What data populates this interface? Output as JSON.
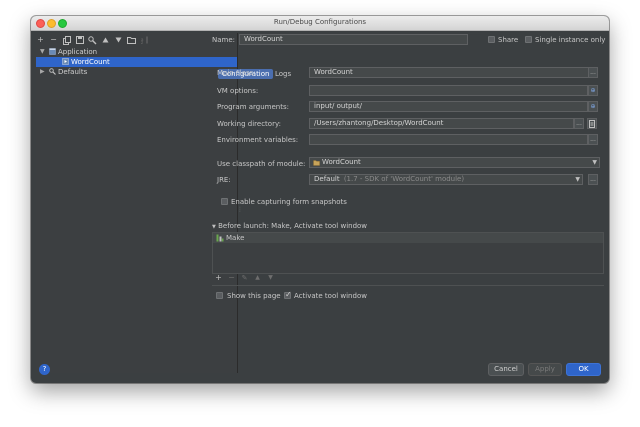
{
  "window": {
    "title": "Run/Debug Configurations"
  },
  "toolbar": {
    "add": "+",
    "remove": "−",
    "copy": "⧉",
    "save": "💾",
    "settings": "⚙",
    "up": "▲",
    "down": "▼",
    "folder": "📁",
    "sort": "⇅"
  },
  "tree": {
    "items": [
      {
        "label": "Application",
        "expanded": true
      },
      {
        "label": "WordCount",
        "selected": true
      },
      {
        "label": "Defaults",
        "expanded": false
      }
    ]
  },
  "header": {
    "name_label": "Name:",
    "name_value": "WordCount",
    "share_label": "Share",
    "single_instance_label": "Single instance only"
  },
  "tabs": [
    {
      "label": "Configuration",
      "active": true
    },
    {
      "label": "Logs",
      "active": false
    }
  ],
  "form": {
    "main_class_label": "Main class:",
    "main_class_value": "WordCount",
    "vm_options_label": "VM options:",
    "vm_options_value": "",
    "program_args_label": "Program arguments:",
    "program_args_value": "input/ output/",
    "working_dir_label": "Working directory:",
    "working_dir_value": "/Users/zhantong/Desktop/WordCount",
    "env_vars_label": "Environment variables:",
    "env_vars_value": "",
    "classpath_label": "Use classpath of module:",
    "classpath_value": "WordCount",
    "jre_label": "JRE:",
    "jre_value": "Default",
    "jre_hint": "(1.7 - SDK of 'WordCount' module)",
    "form_snapshots_label": "Enable capturing form snapshots",
    "ellipsis": "...",
    "expand": "⊕"
  },
  "before_launch": {
    "title": "Before launch: Make, Activate tool window",
    "items": [
      "Make"
    ],
    "add": "+",
    "remove": "−",
    "edit": "✎",
    "up": "▲",
    "down": "▼"
  },
  "options": {
    "show_page_label": "Show this page",
    "show_page_checked": false,
    "activate_tool_label": "Activate tool window",
    "activate_tool_checked": true
  },
  "footer": {
    "help": "?",
    "cancel": "Cancel",
    "apply": "Apply",
    "ok": "OK"
  },
  "colors": {
    "accent": "#2f65ca",
    "background": "#3b3f41",
    "field": "#45494a"
  }
}
